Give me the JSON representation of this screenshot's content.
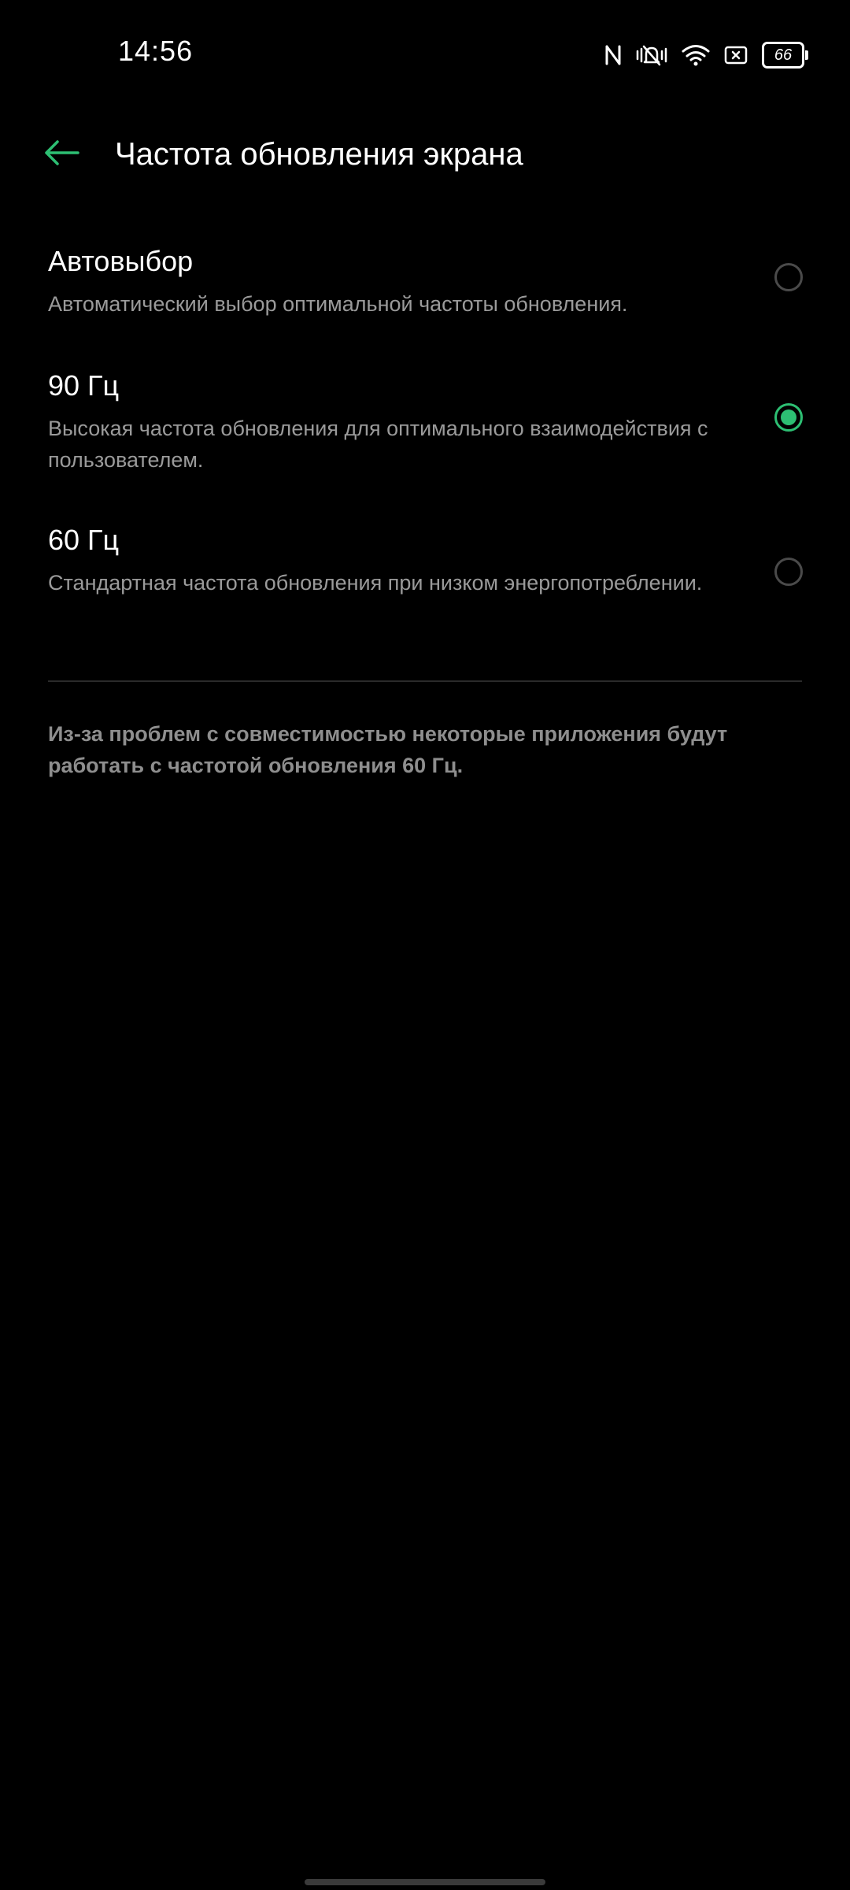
{
  "status_bar": {
    "time": "14:56",
    "battery_level": "66",
    "icons": [
      "nfc-icon",
      "vibrate-mute-icon",
      "wifi-icon",
      "sim-icon",
      "battery-icon"
    ]
  },
  "header": {
    "title": "Частота обновления экрана",
    "back_icon": "back-arrow-icon"
  },
  "options": [
    {
      "title": "Автовыбор",
      "description": "Автоматический выбор оптимальной частоты обновления.",
      "selected": false
    },
    {
      "title": "90 Гц",
      "description": "Высокая частота обновления для оптимального взаимодействия с пользователем.",
      "selected": true
    },
    {
      "title": "60 Гц",
      "description": "Стандартная частота обновления при низком энергопотреблении.",
      "selected": false
    }
  ],
  "footnote": "Из-за проблем с совместимостью некоторые приложения будут работать с частотой обновления 60 Гц.",
  "colors": {
    "accent": "#2dbf73",
    "background": "#000000",
    "secondary_text": "#9a9a9a"
  }
}
